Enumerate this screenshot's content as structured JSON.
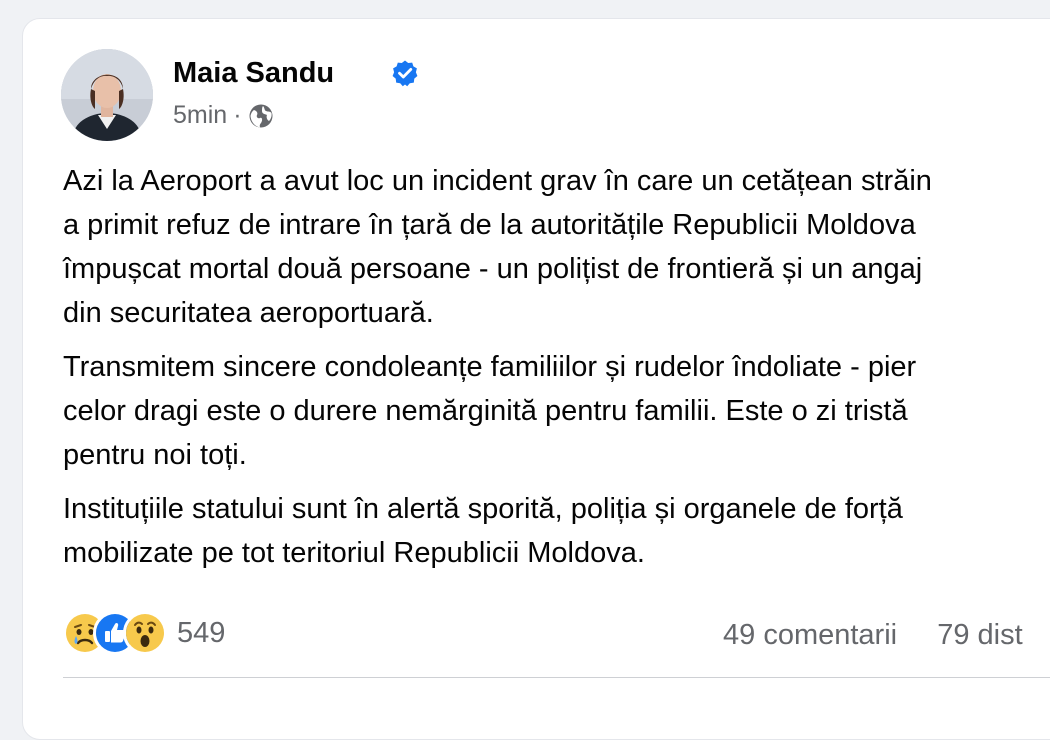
{
  "post": {
    "author": "Maia Sandu",
    "verified_icon": "verified-badge-icon",
    "time": "5min",
    "separator": "·",
    "audience_icon": "globe-icon",
    "paragraphs": [
      "Azi la Aeroport a avut loc un incident grav în care un cetățean străin\na primit refuz de intrare în țară de la autoritățile Republicii Moldova\nîmpușcat mortal două persoane - un polițist de frontieră și un angaj\ndin securitatea aeroportuară.",
      "Transmitem sincere condoleanțe familiilor și rudelor îndoliate - pier\ncelor dragi este o durere nemărginită pentru familii. Este o zi tristă\npentru noi toți.",
      "Instituțiile statului sunt în alertă sporită, poliția și organele de forță\nmobilizate pe tot teritoriul Republicii Moldova."
    ],
    "reactions": {
      "icons": [
        "sad-reaction-icon",
        "like-reaction-icon",
        "wow-reaction-icon"
      ],
      "count": "549"
    },
    "comments": "49 comentarii",
    "shares": "79 dist"
  },
  "colors": {
    "text": "#050505",
    "secondary": "#65676b",
    "verified": "#1877f2",
    "like": "#1877f2",
    "emoji": "#f7c94c"
  }
}
